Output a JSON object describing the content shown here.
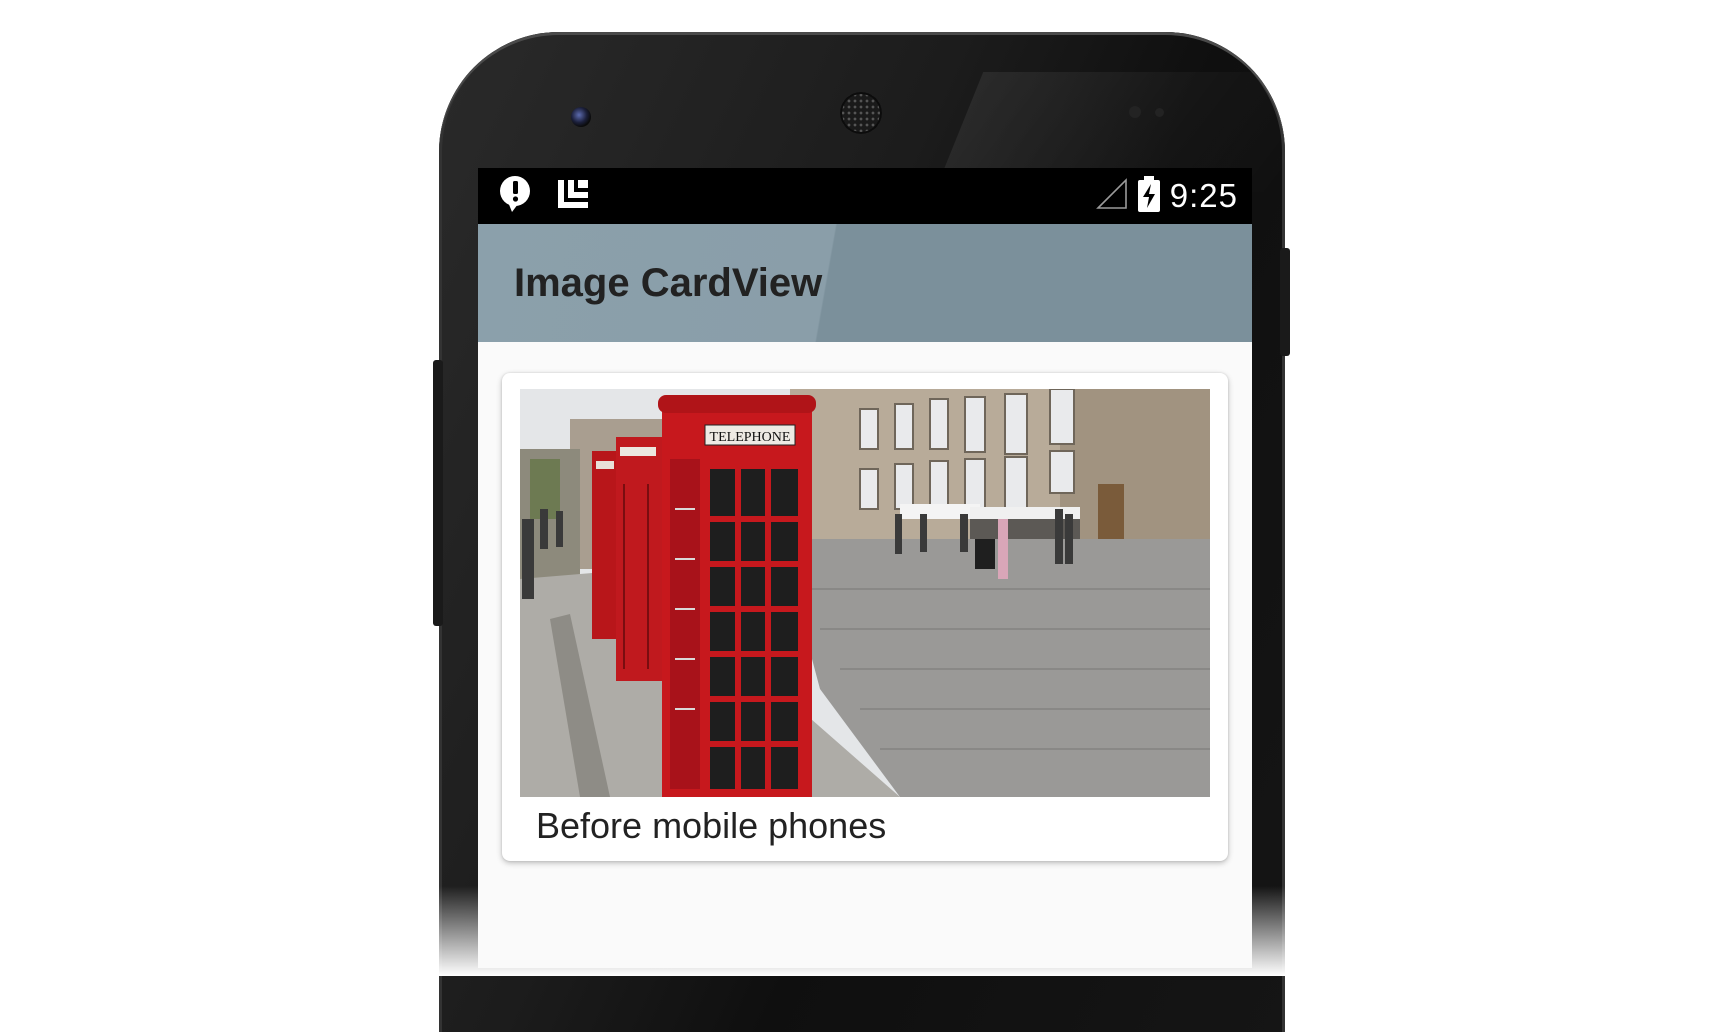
{
  "status_bar": {
    "time": "9:25",
    "left_icons": [
      "alert-icon",
      "app-icon"
    ],
    "right_icons": [
      "signal-icon",
      "battery-charging-icon"
    ]
  },
  "app_bar": {
    "title": "Image CardView",
    "colors": {
      "primary": "#8a9ea9"
    }
  },
  "card": {
    "caption": "Before mobile phones",
    "image_alt": "TELEPHONE",
    "image_sign": "TELEPHONE"
  }
}
